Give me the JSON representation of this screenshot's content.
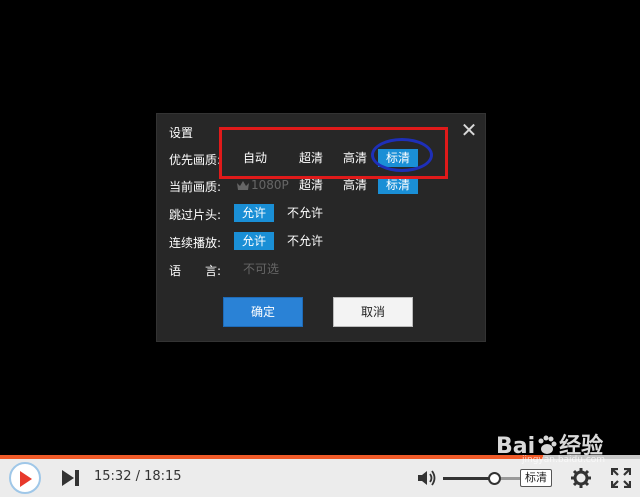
{
  "dialog": {
    "title": "设置",
    "close_glyph": "✕",
    "rows": {
      "preferred_quality": {
        "label": "优先画质:",
        "options": [
          "自动",
          "超清",
          "高清",
          "标清"
        ]
      },
      "current_quality": {
        "label": "当前画质:",
        "options": [
          "1080P",
          "超清",
          "高清",
          "标清"
        ]
      },
      "skip_intro": {
        "label": "跳过片头:",
        "options": [
          "允许",
          "不允许"
        ]
      },
      "autoplay": {
        "label": "连续播放:",
        "options": [
          "允许",
          "不允许"
        ]
      },
      "language": {
        "label": "语　　言:",
        "value": "不可选"
      }
    },
    "ok_label": "确定",
    "cancel_label": "取消"
  },
  "player": {
    "time": "15:32 / 18:15",
    "progress_fraction": 0.849,
    "volume_fraction": 0.6,
    "quality_label": "标清"
  },
  "watermark": {
    "text_a": "Bai",
    "text_b": "经验",
    "sub": "jingyan.baidu.com"
  },
  "colors": {
    "selected": "#1a8fd6",
    "progress": "#f05a28",
    "annotation_box": "#e01a1a",
    "annotation_ellipse": "#1e2fb8"
  }
}
